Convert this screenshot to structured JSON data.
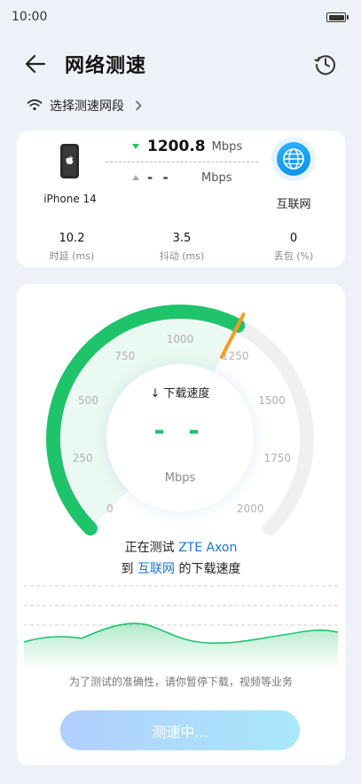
{
  "status_bar": {
    "time": "10:00",
    "battery_icon": "battery-full-icon"
  },
  "header": {
    "title": "网络测速",
    "back_icon": "back-arrow-icon",
    "history_icon": "history-icon"
  },
  "segment": {
    "label": "选择测速网段",
    "wifi_icon": "wifi-icon",
    "chevron_icon": "chevron-right-icon"
  },
  "summary": {
    "device_name": "iPhone 14",
    "download_value": "1200.8",
    "download_unit": "Mbps",
    "upload_value": "- -",
    "upload_unit": "Mbps",
    "network_name": "互联网",
    "metrics": [
      {
        "value": "10.2",
        "label": "时延 (ms)"
      },
      {
        "value": "3.5",
        "label": "抖动 (ms)"
      },
      {
        "value": "0",
        "label": "丢包 (%)"
      }
    ]
  },
  "gauge": {
    "ticks": [
      "0",
      "250",
      "500",
      "750",
      "1000",
      "1250",
      "1500",
      "1750",
      "2000"
    ],
    "max": 2000,
    "current": 1200.8,
    "title": "↓ 下载速度",
    "value": "- -",
    "unit": "Mbps",
    "colors": {
      "active": "#1fc46a",
      "track": "#f0f0f0",
      "needle": "#f59a23"
    }
  },
  "testing": {
    "line1_prefix": "正在测试",
    "target": "ZTE Axon",
    "line2_prefix": "到",
    "network": "互联网",
    "line2_suffix": "的下载速度"
  },
  "tip": "为了测试的准确性，请你暂停下载，视频等业务",
  "button": {
    "label": "测速中..."
  }
}
